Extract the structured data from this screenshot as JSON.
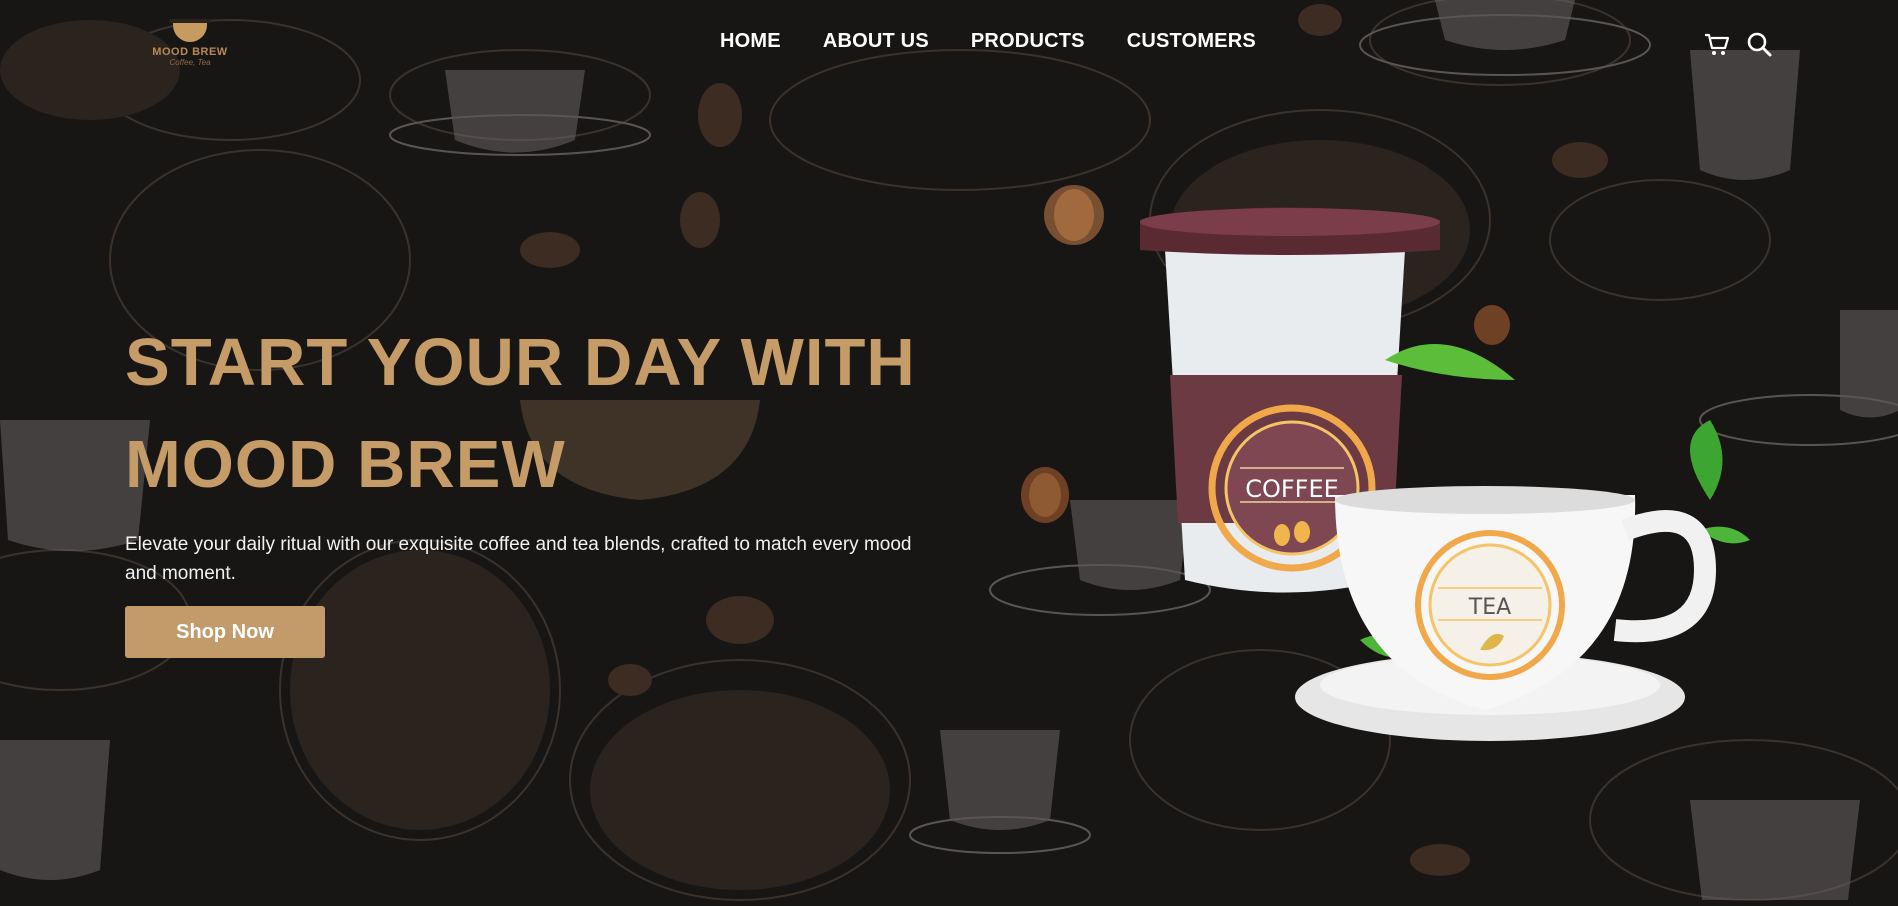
{
  "brand": {
    "name": "MOOD BREW",
    "tagline": "Coffee, Tea"
  },
  "nav": {
    "items": [
      "HOME",
      "ABOUT US",
      "PRODUCTS",
      "CUSTOMERS"
    ]
  },
  "header_icons": [
    "cart-icon",
    "search-icon"
  ],
  "hero": {
    "title_line1": "START YOUR DAY WITH",
    "title_line2": "MOOD BREW",
    "description": "Elevate your daily ritual with our exquisite coffee and tea blends, crafted to match every mood and moment.",
    "cta": "Shop Now"
  },
  "products": {
    "coffee_label": "COFFEE",
    "tea_label": "TEA"
  },
  "colors": {
    "background": "#181615",
    "accent": "#c59b67",
    "button": "#c39b6a",
    "cup_sleeve": "#6b3a43"
  }
}
